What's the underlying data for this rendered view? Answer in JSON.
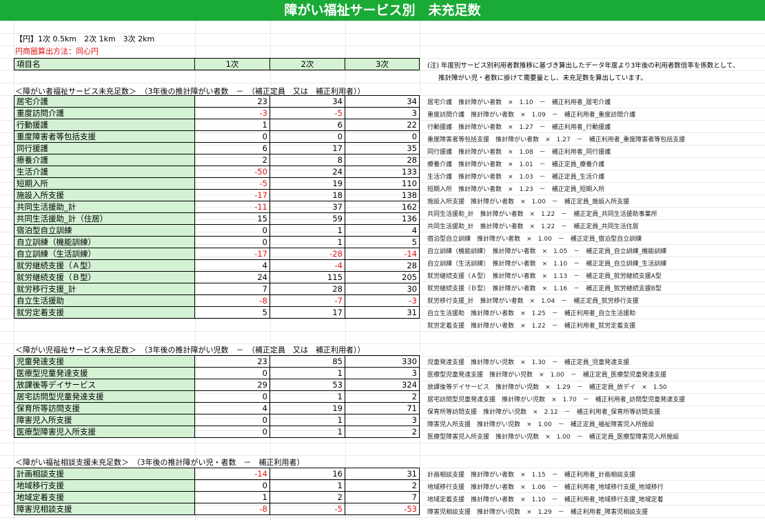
{
  "title": "障がい福祉サービス別　未充足数",
  "legend_circle": "【円】1次 0.5km　2次 1km　3次 2km",
  "circle_method": "円商圏算出方法：同心円",
  "header": {
    "name": "項目名",
    "c1": "1次",
    "c2": "2次",
    "c3": "3次"
  },
  "note_line1": "(注) 年度別サービス別利用者数推移に基づき算出したデータ年度より3年後の利用者数倍率を係数として、",
  "note_line2": "推計障がい児・者数に掛けて需要量とし、未充足数を算出しています。",
  "section1": {
    "title": "＜障がい者福祉サービス未充足数＞　（3年後の推計障がい者数　－　（補正定員　又は　補正利用者））",
    "rows": [
      {
        "name": "居宅介護",
        "v1": "23",
        "v2": "34",
        "v3": "34",
        "formula": "居宅介護　推計障がい者数　×　1.10　－　補正利用者_居宅介護"
      },
      {
        "name": "重度訪問介護",
        "v1": "-3",
        "v2": "-5",
        "v3": "3",
        "formula": "重度訪問介護　推計障がい者数　×　1.09　－　補正利用者_重度訪問介護"
      },
      {
        "name": "行動援護",
        "v1": "1",
        "v2": "6",
        "v3": "22",
        "formula": "行動援護　推計障がい者数　×　1.27　－　補正利用者_行動援護"
      },
      {
        "name": "重度障害者等包括支援",
        "v1": "0",
        "v2": "0",
        "v3": "0",
        "formula": "重度障害者等包括支援　推計障がい者数　×　1.27　－　補正利用者_重度障害者等包括支援"
      },
      {
        "name": "同行援護",
        "v1": "6",
        "v2": "17",
        "v3": "35",
        "formula": "同行援護　推計障がい者数　×　1.08　－　補正利用者_同行援護"
      },
      {
        "name": "療養介護",
        "v1": "2",
        "v2": "8",
        "v3": "28",
        "formula": "療養介護　推計障がい者数　×　1.01　－　補正定員_療養介護"
      },
      {
        "name": "生活介護",
        "v1": "-50",
        "v2": "24",
        "v3": "133",
        "formula": "生活介護　推計障がい者数　×　1.03　－　補正定員_生活介護"
      },
      {
        "name": "短期入所",
        "v1": "-5",
        "v2": "19",
        "v3": "110",
        "formula": "短期入所　推計障がい者数　×　1.23　－　補正定員_短期入所"
      },
      {
        "name": "施設入所支援",
        "v1": "-17",
        "v2": "18",
        "v3": "138",
        "formula": "施設入所支援　推計障がい者数　×　1.00　－　補正定員_施設入所支援"
      },
      {
        "name": "共同生活援助_計",
        "v1": "-11",
        "v2": "37",
        "v3": "162",
        "formula": "共同生活援助_計　推計障がい者数　×　1.22　－　補正定員_共同生活援助事業所"
      },
      {
        "name": "共同生活援助_計（住居）",
        "v1": "15",
        "v2": "59",
        "v3": "136",
        "formula": "共同生活援助_計　推計障がい者数　×　1.22　－　補正定員_共同生活住居"
      },
      {
        "name": "宿泊型自立訓練",
        "v1": "0",
        "v2": "1",
        "v3": "4",
        "formula": "宿泊型自立訓練　推計障がい者数　×　1.00　－　補正定員_宿泊型自立訓練"
      },
      {
        "name": "自立訓練（機能訓練）",
        "v1": "0",
        "v2": "1",
        "v3": "5",
        "formula": "自立訓練（機能訓練）　推計障がい者数　×　1.05　－　補正定員_自立訓練_機能訓練"
      },
      {
        "name": "自立訓練（生活訓練）",
        "v1": "-17",
        "v2": "-28",
        "v3": "-14",
        "formula": "自立訓練（生活訓練）　推計障がい者数　×　1.10　－　補正定員_自立訓練_生活訓練"
      },
      {
        "name": "就労継続支援（Ａ型）",
        "v1": "4",
        "v2": "-4",
        "v3": "28",
        "formula": "就労継続支援（Ａ型）　推計障がい者数　×　1.13　－　補正定員_就労継続支援A型"
      },
      {
        "name": "就労継続支援（Ｂ型）",
        "v1": "24",
        "v2": "115",
        "v3": "205",
        "formula": "就労継続支援（Ｂ型）　推計障がい者数　×　1.16　－　補正定員_就労継続支援B型"
      },
      {
        "name": "就労移行支援_計",
        "v1": "7",
        "v2": "28",
        "v3": "30",
        "formula": "就労移行支援_計　推計障がい者数　×　1.04　－　補正定員_就労移行支援"
      },
      {
        "name": "自立生活援助",
        "v1": "-8",
        "v2": "-7",
        "v3": "-3",
        "formula": "自立生活援助　推計障がい者数　×　1.25　－　補正利用者_自立生活援助"
      },
      {
        "name": "就労定着支援",
        "v1": "5",
        "v2": "17",
        "v3": "31",
        "formula": "就労定着支援　推計障がい者数　×　1.22　－　補正利用者_就労定着支援"
      }
    ]
  },
  "section2": {
    "title": "＜障がい児福祉サービス未充足数＞　（3年後の推計障がい児数　－　（補正定員　又は　補正利用者））",
    "rows": [
      {
        "name": "児童発達支援",
        "v1": "23",
        "v2": "85",
        "v3": "330",
        "formula": "児童発達支援　推計障がい児数　×　1.30　－　補正定員_児童発達支援"
      },
      {
        "name": "医療型児童発達支援",
        "v1": "0",
        "v2": "1",
        "v3": "3",
        "formula": "医療型児童発達支援　推計障がい児数　×　1.00　－　補正定員_医療型児童発達支援"
      },
      {
        "name": "放課後等デイサービス",
        "v1": "29",
        "v2": "53",
        "v3": "324",
        "formula": "放課後等デイサービス　推計障がい児数　×　1.29　－　補正定員_放デイ　×　1.50"
      },
      {
        "name": "居宅訪問型児童発達支援",
        "v1": "0",
        "v2": "1",
        "v3": "2",
        "formula": "居宅訪問型児童発達支援　推計障がい児数　×　1.70　－　補正利用者_訪問型児童発達支援"
      },
      {
        "name": "保育所等訪問支援",
        "v1": "4",
        "v2": "19",
        "v3": "71",
        "formula": "保育所等訪問支援　推計障がい児数　×　2.12　－　補正利用者_保育所等訪問支援"
      },
      {
        "name": "障害児入所支援",
        "v1": "0",
        "v2": "1",
        "v3": "3",
        "formula": "障害児入所支援　推計障がい児数　×　1.00　－　補正定員_福祉障害児入所施設"
      },
      {
        "name": "医療型障害児入所支援",
        "v1": "0",
        "v2": "1",
        "v3": "2",
        "formula": "医療型障害児入所支援　推計障がい児数　×　1.00　－　補正定員_医療型障害児入所施設"
      }
    ]
  },
  "section3": {
    "title": "＜障がい福祉相談支援未充足数＞　（3年後の推計障がい児・者数　－　補正利用者）",
    "rows": [
      {
        "name": "計画相談支援",
        "v1": "-14",
        "v2": "16",
        "v3": "31",
        "formula": "計画相談支援　推計障がい者数　×　1.15　－　補正利用者_計画相談支援"
      },
      {
        "name": "地域移行支援",
        "v1": "0",
        "v2": "1",
        "v3": "2",
        "formula": "地域移行支援　推計障がい者数　×　1.06　－　補正利用者_地域移行支援_地域移行"
      },
      {
        "name": "地域定着支援",
        "v1": "1",
        "v2": "2",
        "v3": "7",
        "formula": "地域定着支援　推計障がい者数　×　1.10　－　補正利用者_地域移行支援_地域定着"
      },
      {
        "name": "障害児相談支援",
        "v1": "-8",
        "v2": "-5",
        "v3": "-53",
        "formula": "障害児相談支援　推計障がい児数　×　1.29　－　補正利用者_障害児相談支援"
      }
    ]
  }
}
